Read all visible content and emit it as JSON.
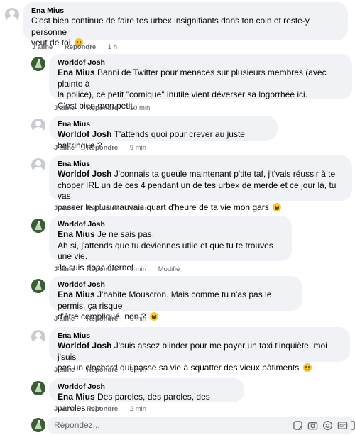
{
  "actions": {
    "like": "J'aime",
    "reply": "Répondre"
  },
  "comments": [
    {
      "author": "Ena Mius",
      "segments": [
        {
          "mention": "",
          "text": "C'est bien continue de faire tes urbex insignifiants dans ton coin et reste-y personne\nveut de toi "
        }
      ],
      "time": "1 h",
      "edited": ""
    },
    {
      "author": "Worldof Josh",
      "mention": "Ena Mius",
      "text": " Banni de Twitter pour menaces sur plusieurs membres (avec plainte à\nla police), ce petit \"comique\" inutile vient déverser sa logorrhée ici.\nC'est bien mon petit.",
      "time": "10 min",
      "edited": ""
    },
    {
      "author": "Ena Mius",
      "mention": "Worldof Josh",
      "text": " T'attends quoi pour crever au juste baltringue ?",
      "time": "9 min",
      "edited": ""
    },
    {
      "author": "Ena Mius",
      "mention": "Worldof Josh",
      "text": " J'connais ta gueule maintenant p'tite taf, j't'vais réussir à te\nchoper IRL un de ces 4 pendant un de tes urbex de merde et ce jour là, tu vas\npasser le plus mauvais quart d'heure de ta vie mon gars ",
      "time": "6 min",
      "edited": ""
    },
    {
      "author": "Worldof Josh",
      "mention": "Ena Mius",
      "text": " Je ne sais pas.\nAh si, j'attends que tu deviennes utile et que tu te trouves une vie.\nJe suis donc éternel.",
      "time": "6 min",
      "edited": "Modifié"
    },
    {
      "author": "Worldof Josh",
      "mention": "Ena Mius",
      "text": " J'habite Mouscron. Mais comme tu n'as pas le permis, ça risque\nd'être compliqué, non ? ",
      "time": "5 min",
      "edited": ""
    },
    {
      "author": "Ena Mius",
      "mention": "Worldof Josh",
      "text": " J'suis assez blinder pour me payer un taxi t'inquiète, moi j'suis\npas un clochard qui passe sa vie à squatter des vieux bâtiments ",
      "time": "3 min",
      "edited": ""
    },
    {
      "author": "Worldof Josh",
      "mention": "Ena Mius",
      "text": " Des paroles, des paroles, des paroles ",
      "notes": "♪♫♪",
      "time": "2 min",
      "edited": ""
    }
  ],
  "reply_box": {
    "placeholder": "Répondez..."
  },
  "icons": {
    "avatar_default": "default-avatar-icon",
    "avatar_josh": "profile-photo-avatar",
    "tools": [
      "sticker-icon",
      "camera-icon",
      "emoji-icon",
      "gif-icon",
      "sticker-alt-icon"
    ]
  },
  "colors": {
    "bubble": "#f0f2f5",
    "meta": "#65676b",
    "text": "#050505"
  }
}
